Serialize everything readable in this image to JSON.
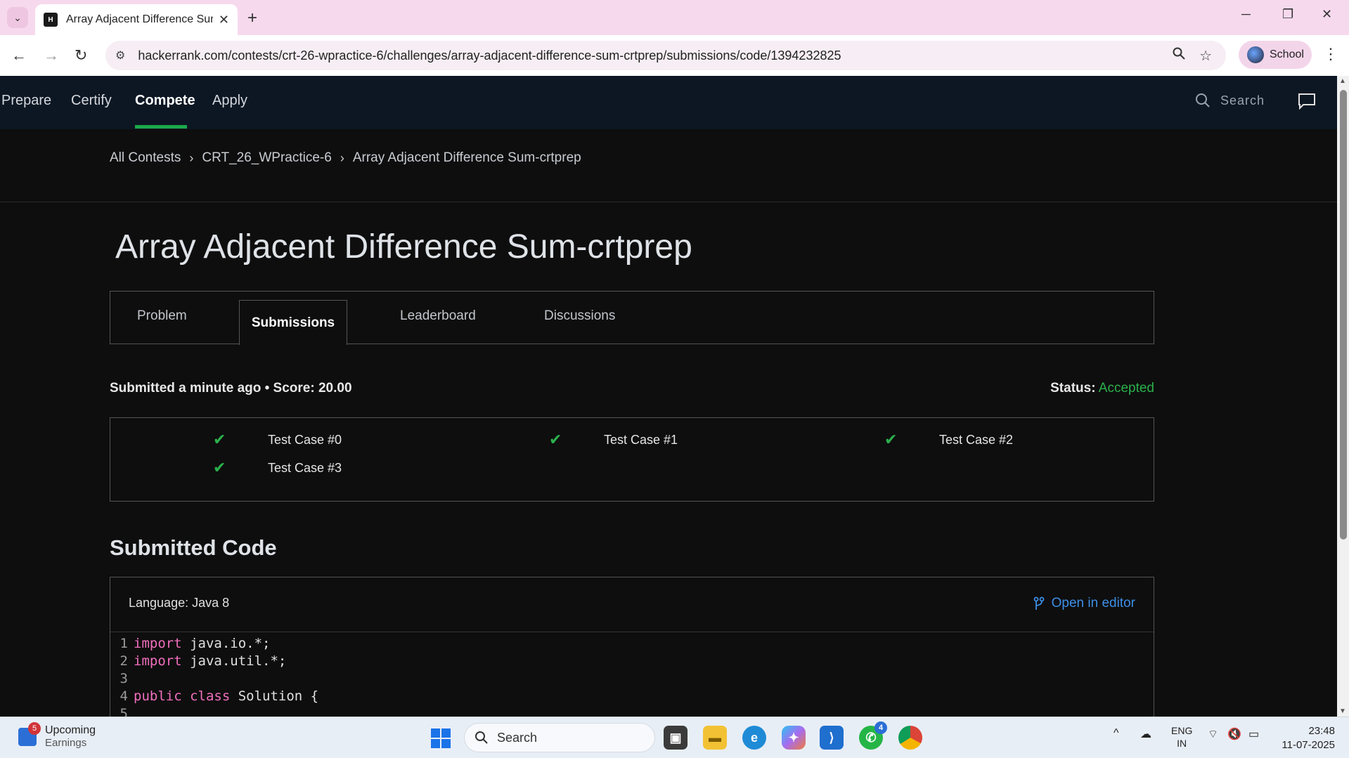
{
  "browser": {
    "tab_title": "Array Adjacent Difference Sum-",
    "favicon_text": "H",
    "url": "hackerrank.com/contests/crt-26-wpractice-6/challenges/array-adjacent-difference-sum-crtprep/submissions/code/1394232825",
    "profile_label": "School"
  },
  "nav": {
    "items": [
      "Prepare",
      "Certify",
      "Compete",
      "Apply"
    ],
    "active": "Compete",
    "search_placeholder": "Search"
  },
  "breadcrumb": [
    "All Contests",
    "CRT_26_WPractice-6",
    "Array Adjacent Difference Sum-crtprep"
  ],
  "challenge": {
    "title": "Array Adjacent Difference Sum-crtprep",
    "tabs": [
      "Problem",
      "Submissions",
      "Leaderboard",
      "Discussions"
    ],
    "selected_tab": "Submissions"
  },
  "submission": {
    "summary": "Submitted a minute ago • Score: 20.00",
    "status_label": "Status:",
    "status_value": "Accepted",
    "status_color": "#2bb04d",
    "test_cases": [
      "Test Case #0",
      "Test Case #1",
      "Test Case #2",
      "Test Case #3"
    ]
  },
  "code": {
    "heading": "Submitted Code",
    "language": "Language: Java 8",
    "open_in_editor": "Open in editor",
    "lines": [
      {
        "n": "1",
        "kw": "import",
        "rest": " java.io.*;"
      },
      {
        "n": "2",
        "kw": "import",
        "rest": " java.util.*;"
      },
      {
        "n": "3",
        "kw": "",
        "rest": ""
      },
      {
        "n": "4",
        "kw": "public class",
        "rest": " Solution {"
      },
      {
        "n": "5",
        "kw": "",
        "rest": ""
      }
    ],
    "keyword_color": "#f06fbd"
  },
  "taskbar": {
    "weather_title": "Upcoming",
    "weather_subtitle": "Earnings",
    "weather_badge": "5",
    "search_placeholder": "Search",
    "whatsapp_badge": "4",
    "lang_top": "ENG",
    "lang_bottom": "IN",
    "time": "23:48",
    "date": "11-07-2025"
  }
}
